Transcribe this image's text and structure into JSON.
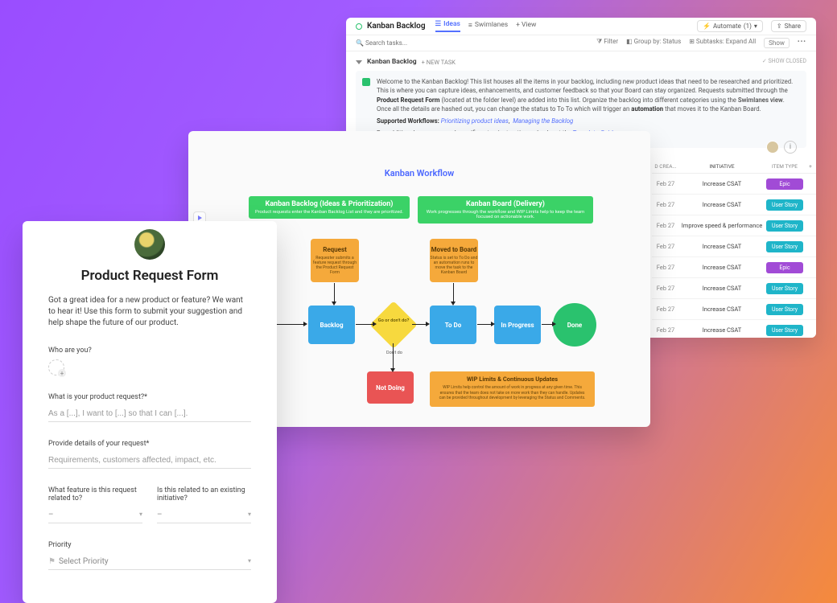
{
  "kanban": {
    "title": "Kanban Backlog",
    "tabs": {
      "ideas": "Ideas",
      "swimlanes": "Swimlanes",
      "addView": "+ View"
    },
    "right": {
      "automate": "Automate",
      "automateCount": "(1)",
      "share": "Share"
    },
    "toolbar": {
      "searchPlaceholder": "Search tasks...",
      "filter": "Filter",
      "group": "Group by: Status",
      "subtasks": "Subtasks: Expand All",
      "show": "Show",
      "more": "•••"
    },
    "list": {
      "name": "Kanban Backlog",
      "newTask": "+ NEW TASK",
      "showClosed": "SHOW CLOSED"
    },
    "info": {
      "p1a": "Welcome to the Kanban Backlog! This list houses all the items in your backlog, including new product ideas that need to be researched and prioritized. This is where you can capture ideas, enhancements, and customer feedback so that your Board can stay organized. Requests submitted through the ",
      "p1b": "Product Request Form",
      "p1c": " (located at the folder level) are added into this list. Organize the backlog into different categories using the ",
      "p1d": "Swimlanes view",
      "p1e": ". Once all the details are hashed out, you can change the status to To To which will trigger an ",
      "p1f": "automation",
      "p1g": " that moves it to the Kanban Board.",
      "p2a": "Supported Workflows: ",
      "p2b": "Prioritizing product ideas",
      "p2c": "Managing the Backlog",
      "p3a": "For additional resources and specific setup instructions, check out the ",
      "p3b": "Template Guide"
    },
    "table": {
      "headers": {
        "date": "D CREA...",
        "initiative": "INITIATIVE",
        "type": "ITEM TYPE",
        "plus": "+"
      },
      "rows": [
        {
          "date": "Feb 27",
          "initiative": "Increase CSAT",
          "type": "Epic",
          "cls": "pill-epic"
        },
        {
          "date": "Feb 27",
          "initiative": "Increase CSAT",
          "type": "User Story",
          "cls": "pill-us"
        },
        {
          "date": "Feb 27",
          "initiative": "Improve speed & performance",
          "type": "User Story",
          "cls": "pill-us"
        },
        {
          "date": "Feb 27",
          "initiative": "Increase CSAT",
          "type": "User Story",
          "cls": "pill-us"
        },
        {
          "date": "Feb 27",
          "initiative": "Increase CSAT",
          "type": "Epic",
          "cls": "pill-epic"
        },
        {
          "date": "Feb 27",
          "initiative": "Increase CSAT",
          "type": "User Story",
          "cls": "pill-us"
        },
        {
          "date": "Feb 27",
          "initiative": "Increase CSAT",
          "type": "User Story",
          "cls": "pill-us"
        },
        {
          "date": "Feb 27",
          "initiative": "Increase CSAT",
          "type": "User Story",
          "cls": "pill-us"
        }
      ]
    }
  },
  "workflow": {
    "title": "Kanban Workflow",
    "sectA": {
      "h": "Kanban Backlog (Ideas & Prioritization)",
      "s": "Product requests enter the Kanban Backlog List and they are prioritized."
    },
    "sectB": {
      "h": "Kanban Board (Delivery)",
      "s": "Work progresses through the workflow and WIP Limits help to keep the team focused on actionable work."
    },
    "req": {
      "h": "Request",
      "s": "Requester submits a feature request through the Product Request Form"
    },
    "moved": {
      "h": "Moved to Board",
      "s": "Status is set to To Do and an automation runs to move the task to the Kanban Board"
    },
    "backlog": "Backlog",
    "decide": "Go or don't do?",
    "todo": "To Do",
    "inprog": "In Progress",
    "done": "Done",
    "notdoing": "Not Doing",
    "dont": "Don't do",
    "wip": {
      "h": "WIP Limits & Continuous Updates",
      "s": "WIP Limits help control the amount of work in progress at any given time. This ensures that the team does not take on more work than they can handle. Updates can be provided throughout development by leveraging the Status and Comments."
    }
  },
  "form": {
    "title": "Product Request Form",
    "intro": "Got a great idea for a new product or feature? We want to hear it! Use this form to submit your suggestion and help shape the future of our product.",
    "who": "Who are you?",
    "q1": "What is your product request?*",
    "q1ph": "As a [...], I want to [...] so that I can [...].",
    "q2": "Provide details of your request*",
    "q2ph": "Requirements, customers affected, impact, etc.",
    "q3": "What feature is this request related to?",
    "q4": "Is this related to an existing initiative?",
    "dash": "–",
    "priority": "Priority",
    "priorityPh": "Select Priority"
  }
}
